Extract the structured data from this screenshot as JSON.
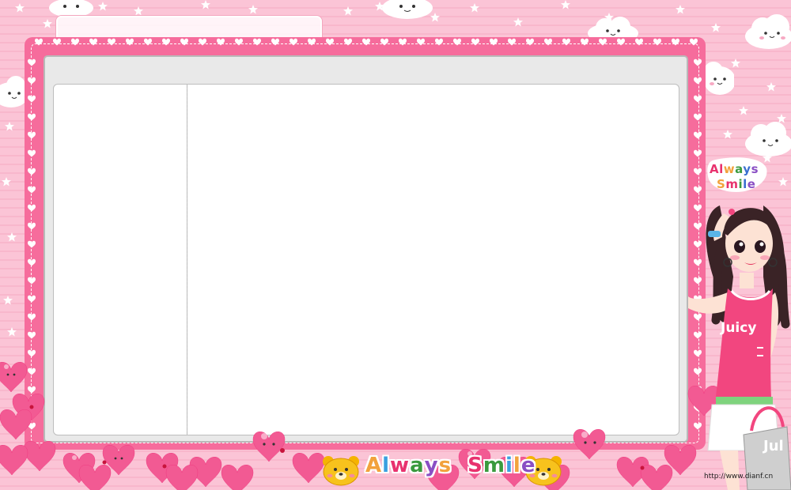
{
  "window": {
    "title_text": "",
    "frame_color": "#f66c9c",
    "background_color": "#fbc4d6",
    "panel_color": "#e9e9e9"
  },
  "callout": {
    "line1": "Always",
    "line2": "Smile",
    "line1_colors": [
      "#e8326e",
      "#e8326e",
      "#f2a23c",
      "#3a9a3e",
      "#3a6fd0",
      "#8a4fc4"
    ],
    "line2_colors": [
      "#f2a23c",
      "#e8326e",
      "#3a9a3e",
      "#3a6fd0",
      "#8a4fc4"
    ]
  },
  "girl": {
    "shirt_text": "Juicy",
    "bag_text": "Jul"
  },
  "footer": {
    "word1": "Always",
    "word2": "Smile",
    "word1_colors": [
      "#f2a23c",
      "#3aa0e0",
      "#e8326e",
      "#3a9a3e",
      "#8a4fc4",
      "#f2a23c"
    ],
    "word2_colors": [
      "#e8326e",
      "#3a9a3e",
      "#3aa0e0",
      "#f2a23c",
      "#8a4fc4"
    ]
  },
  "watermark": "http://www.dianf.cn",
  "icons": [
    "star-icon",
    "cloud-icon",
    "heart-icon",
    "bear-icon"
  ]
}
